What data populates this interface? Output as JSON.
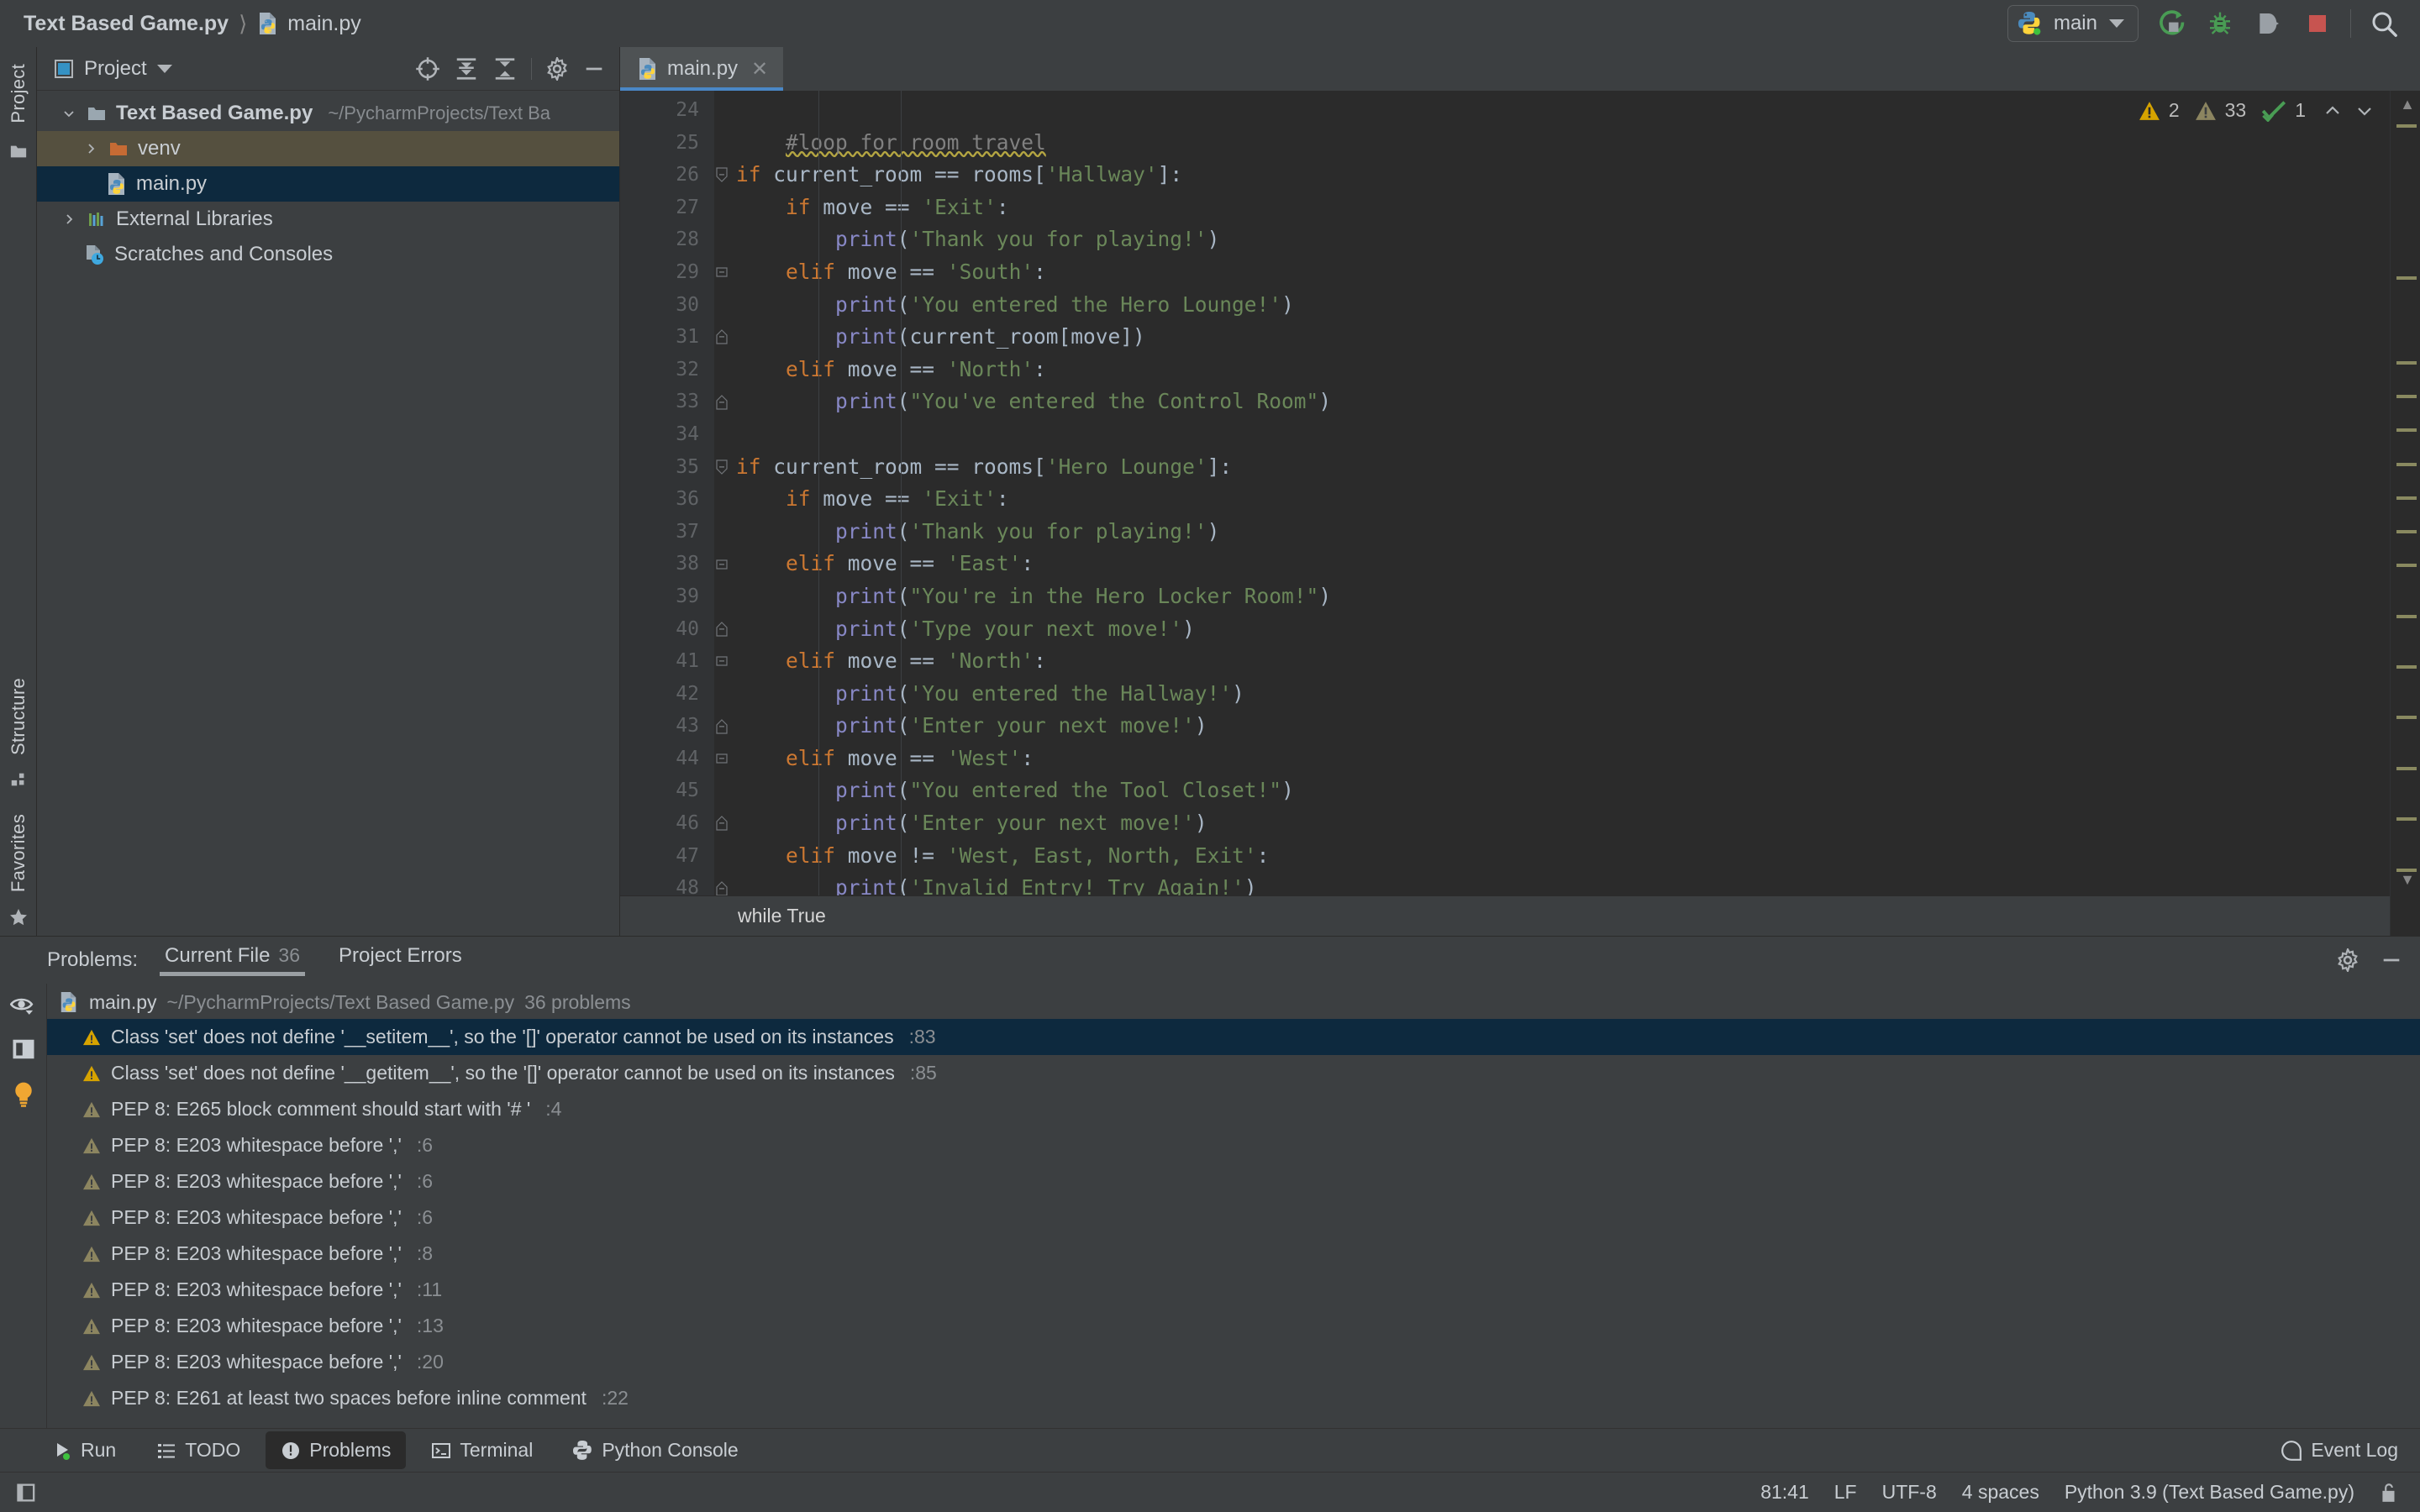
{
  "window": {
    "breadcrumb_project": "Text Based Game.py",
    "breadcrumb_file": "main.py",
    "run_config": "main"
  },
  "toolbar": {
    "run_icon": "run-icon",
    "debug_icon": "debug-icon",
    "run_coverage_icon": "run-with-coverage-icon",
    "stop_icon": "stop-icon",
    "search_icon": "search-everywhere-icon"
  },
  "project_panel": {
    "title": "Project",
    "tools": [
      "select-opened-file-icon",
      "expand-all-icon",
      "collapse-all-icon",
      "settings-icon",
      "hide-icon"
    ],
    "tree": [
      {
        "label": "Text Based Game.py",
        "path": "~/PycharmProjects/Text Ba",
        "icon": "folder-icon",
        "expanded": true,
        "depth": 0,
        "bold": true,
        "state": "normal"
      },
      {
        "label": "venv",
        "path": "",
        "icon": "folder-orange-icon",
        "expanded": false,
        "depth": 1,
        "bold": false,
        "state": "hover"
      },
      {
        "label": "main.py",
        "path": "",
        "icon": "python-file-icon",
        "expanded": null,
        "depth": 2,
        "bold": false,
        "state": "selected"
      },
      {
        "label": "External Libraries",
        "path": "",
        "icon": "library-icon",
        "expanded": false,
        "depth": 0,
        "bold": false,
        "state": "normal"
      },
      {
        "label": "Scratches and Consoles",
        "path": "",
        "icon": "scratches-icon",
        "expanded": null,
        "depth": 0,
        "bold": false,
        "state": "normal"
      }
    ]
  },
  "left_rail": {
    "top_label": "Project",
    "structure_label": "Structure",
    "favorites_label": "Favorites"
  },
  "editor": {
    "tabs": [
      {
        "label": "main.py",
        "icon": "python-file-icon",
        "active": true,
        "closable": true
      }
    ],
    "inlay_hint": "while True",
    "inspections": {
      "warnings": "2",
      "weak_warnings": "33",
      "ok": "1"
    },
    "first_line_number": 24,
    "lines": [
      {
        "n": 24,
        "fold": "",
        "tokens": []
      },
      {
        "n": 25,
        "fold": "",
        "tokens": [
          {
            "t": "    ",
            "c": "d"
          },
          {
            "t": "#loop for room travel",
            "c": "c squiggle"
          }
        ]
      },
      {
        "n": 26,
        "fold": "start",
        "tokens": [
          {
            "t": "if",
            "c": "k"
          },
          {
            "t": " current_room ",
            "c": "d"
          },
          {
            "t": "==",
            "c": "d"
          },
          {
            "t": " rooms[",
            "c": "d"
          },
          {
            "t": "'Hallway'",
            "c": "s"
          },
          {
            "t": "]:",
            "c": "d"
          }
        ]
      },
      {
        "n": 27,
        "fold": "",
        "tokens": [
          {
            "t": "    ",
            "c": "d"
          },
          {
            "t": "if",
            "c": "k"
          },
          {
            "t": " move ",
            "c": "d"
          },
          {
            "t": "==",
            "c": "d"
          },
          {
            "t": " ",
            "c": "d"
          },
          {
            "t": "'Exit'",
            "c": "s"
          },
          {
            "t": ":",
            "c": "d"
          }
        ]
      },
      {
        "n": 28,
        "fold": "",
        "tokens": [
          {
            "t": "        ",
            "c": "d"
          },
          {
            "t": "print",
            "c": "f"
          },
          {
            "t": "(",
            "c": "d"
          },
          {
            "t": "'Thank you for playing!'",
            "c": "s"
          },
          {
            "t": ")",
            "c": "d"
          }
        ]
      },
      {
        "n": 29,
        "fold": "mid",
        "tokens": [
          {
            "t": "    ",
            "c": "d"
          },
          {
            "t": "elif",
            "c": "k"
          },
          {
            "t": " move ",
            "c": "d"
          },
          {
            "t": "==",
            "c": "d"
          },
          {
            "t": " ",
            "c": "d"
          },
          {
            "t": "'South'",
            "c": "s"
          },
          {
            "t": ":",
            "c": "d"
          }
        ]
      },
      {
        "n": 30,
        "fold": "",
        "tokens": [
          {
            "t": "        ",
            "c": "d"
          },
          {
            "t": "print",
            "c": "f"
          },
          {
            "t": "(",
            "c": "d"
          },
          {
            "t": "'You entered the Hero Lounge!'",
            "c": "s"
          },
          {
            "t": ")",
            "c": "d"
          }
        ]
      },
      {
        "n": 31,
        "fold": "end",
        "tokens": [
          {
            "t": "        ",
            "c": "d"
          },
          {
            "t": "print",
            "c": "f"
          },
          {
            "t": "(current_room[move])",
            "c": "d"
          }
        ]
      },
      {
        "n": 32,
        "fold": "",
        "tokens": [
          {
            "t": "    ",
            "c": "d"
          },
          {
            "t": "elif",
            "c": "k"
          },
          {
            "t": " move ",
            "c": "d"
          },
          {
            "t": "==",
            "c": "d"
          },
          {
            "t": " ",
            "c": "d"
          },
          {
            "t": "'North'",
            "c": "s"
          },
          {
            "t": ":",
            "c": "d"
          }
        ]
      },
      {
        "n": 33,
        "fold": "end",
        "tokens": [
          {
            "t": "        ",
            "c": "d"
          },
          {
            "t": "print",
            "c": "f"
          },
          {
            "t": "(",
            "c": "d"
          },
          {
            "t": "\"You've entered the Control Room\"",
            "c": "s"
          },
          {
            "t": ")",
            "c": "d"
          }
        ]
      },
      {
        "n": 34,
        "fold": "",
        "tokens": []
      },
      {
        "n": 35,
        "fold": "start",
        "tokens": [
          {
            "t": "if",
            "c": "k"
          },
          {
            "t": " current_room ",
            "c": "d"
          },
          {
            "t": "==",
            "c": "d"
          },
          {
            "t": " rooms[",
            "c": "d"
          },
          {
            "t": "'Hero Lounge'",
            "c": "s"
          },
          {
            "t": "]:",
            "c": "d"
          }
        ]
      },
      {
        "n": 36,
        "fold": "",
        "tokens": [
          {
            "t": "    ",
            "c": "d"
          },
          {
            "t": "if",
            "c": "k"
          },
          {
            "t": " move ",
            "c": "d"
          },
          {
            "t": "==",
            "c": "d"
          },
          {
            "t": " ",
            "c": "d"
          },
          {
            "t": "'Exit'",
            "c": "s"
          },
          {
            "t": ":",
            "c": "d"
          }
        ]
      },
      {
        "n": 37,
        "fold": "",
        "tokens": [
          {
            "t": "        ",
            "c": "d"
          },
          {
            "t": "print",
            "c": "f"
          },
          {
            "t": "(",
            "c": "d"
          },
          {
            "t": "'Thank you for playing!'",
            "c": "s"
          },
          {
            "t": ")",
            "c": "d"
          }
        ]
      },
      {
        "n": 38,
        "fold": "mid",
        "tokens": [
          {
            "t": "    ",
            "c": "d"
          },
          {
            "t": "elif",
            "c": "k"
          },
          {
            "t": " move ",
            "c": "d"
          },
          {
            "t": "==",
            "c": "d"
          },
          {
            "t": " ",
            "c": "d"
          },
          {
            "t": "'East'",
            "c": "s"
          },
          {
            "t": ":",
            "c": "d"
          }
        ]
      },
      {
        "n": 39,
        "fold": "",
        "tokens": [
          {
            "t": "        ",
            "c": "d"
          },
          {
            "t": "print",
            "c": "f"
          },
          {
            "t": "(",
            "c": "d"
          },
          {
            "t": "\"You're in the Hero Locker Room!\"",
            "c": "s"
          },
          {
            "t": ")",
            "c": "d"
          }
        ]
      },
      {
        "n": 40,
        "fold": "end",
        "tokens": [
          {
            "t": "        ",
            "c": "d"
          },
          {
            "t": "print",
            "c": "f"
          },
          {
            "t": "(",
            "c": "d"
          },
          {
            "t": "'Type your next move!'",
            "c": "s"
          },
          {
            "t": ")",
            "c": "d"
          }
        ]
      },
      {
        "n": 41,
        "fold": "mid",
        "tokens": [
          {
            "t": "    ",
            "c": "d"
          },
          {
            "t": "elif",
            "c": "k"
          },
          {
            "t": " move ",
            "c": "d"
          },
          {
            "t": "==",
            "c": "d"
          },
          {
            "t": " ",
            "c": "d"
          },
          {
            "t": "'North'",
            "c": "s"
          },
          {
            "t": ":",
            "c": "d"
          }
        ]
      },
      {
        "n": 42,
        "fold": "",
        "tokens": [
          {
            "t": "        ",
            "c": "d"
          },
          {
            "t": "print",
            "c": "f"
          },
          {
            "t": "(",
            "c": "d"
          },
          {
            "t": "'You entered the Hallway!'",
            "c": "s"
          },
          {
            "t": ")",
            "c": "d"
          }
        ]
      },
      {
        "n": 43,
        "fold": "end",
        "tokens": [
          {
            "t": "        ",
            "c": "d"
          },
          {
            "t": "print",
            "c": "f"
          },
          {
            "t": "(",
            "c": "d"
          },
          {
            "t": "'Enter your next move!'",
            "c": "s"
          },
          {
            "t": ")",
            "c": "d"
          }
        ]
      },
      {
        "n": 44,
        "fold": "mid",
        "tokens": [
          {
            "t": "    ",
            "c": "d"
          },
          {
            "t": "elif",
            "c": "k"
          },
          {
            "t": " move ",
            "c": "d"
          },
          {
            "t": "==",
            "c": "d"
          },
          {
            "t": " ",
            "c": "d"
          },
          {
            "t": "'West'",
            "c": "s"
          },
          {
            "t": ":",
            "c": "d"
          }
        ]
      },
      {
        "n": 45,
        "fold": "",
        "tokens": [
          {
            "t": "        ",
            "c": "d"
          },
          {
            "t": "print",
            "c": "f"
          },
          {
            "t": "(",
            "c": "d"
          },
          {
            "t": "\"You entered the Tool Closet!\"",
            "c": "s"
          },
          {
            "t": ")",
            "c": "d"
          }
        ]
      },
      {
        "n": 46,
        "fold": "end",
        "tokens": [
          {
            "t": "        ",
            "c": "d"
          },
          {
            "t": "print",
            "c": "f"
          },
          {
            "t": "(",
            "c": "d"
          },
          {
            "t": "'Enter your next move!'",
            "c": "s"
          },
          {
            "t": ")",
            "c": "d"
          }
        ]
      },
      {
        "n": 47,
        "fold": "",
        "tokens": [
          {
            "t": "    ",
            "c": "d"
          },
          {
            "t": "elif",
            "c": "k"
          },
          {
            "t": " move ",
            "c": "d"
          },
          {
            "t": "!=",
            "c": "d"
          },
          {
            "t": " ",
            "c": "d"
          },
          {
            "t": "'West, East, North, Exit'",
            "c": "s"
          },
          {
            "t": ":",
            "c": "d"
          }
        ]
      },
      {
        "n": 48,
        "fold": "end",
        "tokens": [
          {
            "t": "        ",
            "c": "d"
          },
          {
            "t": "print",
            "c": "f"
          },
          {
            "t": "(",
            "c": "d"
          },
          {
            "t": "'Invalid Entry! Try Again!'",
            "c": "s"
          },
          {
            "t": ")",
            "c": "d"
          }
        ]
      }
    ]
  },
  "problems_panel": {
    "label": "Problems:",
    "tabs": [
      {
        "label": "Current File",
        "count": "36",
        "active": true
      },
      {
        "label": "Project Errors",
        "count": "",
        "active": false
      }
    ],
    "header_tools": [
      "settings-icon",
      "hide-icon"
    ],
    "rail_icons": [
      "preview-icon",
      "open-editor-preview-icon",
      "quick-fix-icon"
    ],
    "file": {
      "name": "main.py",
      "path": "~/PycharmProjects/Text Based Game.py",
      "count": "36 problems",
      "icon": "python-file-icon"
    },
    "rows": [
      {
        "severity": "warning",
        "text": "Class 'set' does not define '__setitem__', so the '[]' operator cannot be used on its instances",
        "loc": ":83",
        "selected": true
      },
      {
        "severity": "warning",
        "text": "Class 'set' does not define '__getitem__', so the '[]' operator cannot be used on its instances",
        "loc": ":85",
        "selected": false
      },
      {
        "severity": "weak",
        "text": "PEP 8: E265 block comment should start with '# '",
        "loc": ":4",
        "selected": false
      },
      {
        "severity": "weak",
        "text": "PEP 8: E203 whitespace before ','",
        "loc": ":6",
        "selected": false
      },
      {
        "severity": "weak",
        "text": "PEP 8: E203 whitespace before ','",
        "loc": ":6",
        "selected": false
      },
      {
        "severity": "weak",
        "text": "PEP 8: E203 whitespace before ','",
        "loc": ":6",
        "selected": false
      },
      {
        "severity": "weak",
        "text": "PEP 8: E203 whitespace before ','",
        "loc": ":8",
        "selected": false
      },
      {
        "severity": "weak",
        "text": "PEP 8: E203 whitespace before ','",
        "loc": ":11",
        "selected": false
      },
      {
        "severity": "weak",
        "text": "PEP 8: E203 whitespace before ','",
        "loc": ":13",
        "selected": false
      },
      {
        "severity": "weak",
        "text": "PEP 8: E203 whitespace before ','",
        "loc": ":20",
        "selected": false
      },
      {
        "severity": "weak",
        "text": "PEP 8: E261 at least two spaces before inline comment",
        "loc": ":22",
        "selected": false
      }
    ]
  },
  "bottom_tabs": [
    {
      "label": "Run",
      "icon": "run-icon",
      "active": false
    },
    {
      "label": "TODO",
      "icon": "todo-icon",
      "active": false
    },
    {
      "label": "Problems",
      "icon": "problems-icon",
      "active": true
    },
    {
      "label": "Terminal",
      "icon": "terminal-icon",
      "active": false
    },
    {
      "label": "Python Console",
      "icon": "python-console-icon",
      "active": false
    }
  ],
  "event_log": {
    "label": "Event Log",
    "icon": "event-log-icon"
  },
  "statusbar": {
    "caret": "81:41",
    "line_separator": "LF",
    "encoding": "UTF-8",
    "indent": "4 spaces",
    "interpreter": "Python 3.9 (Text Based Game.py)",
    "lock_icon": "unlocked-icon"
  },
  "colors": {
    "bg_panel": "#3c3f41",
    "bg_editor": "#2b2b2b",
    "accent_selection": "#0d293e",
    "accent_tab": "#4a88c7",
    "keyword": "#cc7832",
    "string": "#6a8759",
    "function": "#8888c6",
    "default_text": "#a9b7c6",
    "comment": "#808080",
    "warning": "#d6a300",
    "weak_warning": "#8c8560"
  }
}
